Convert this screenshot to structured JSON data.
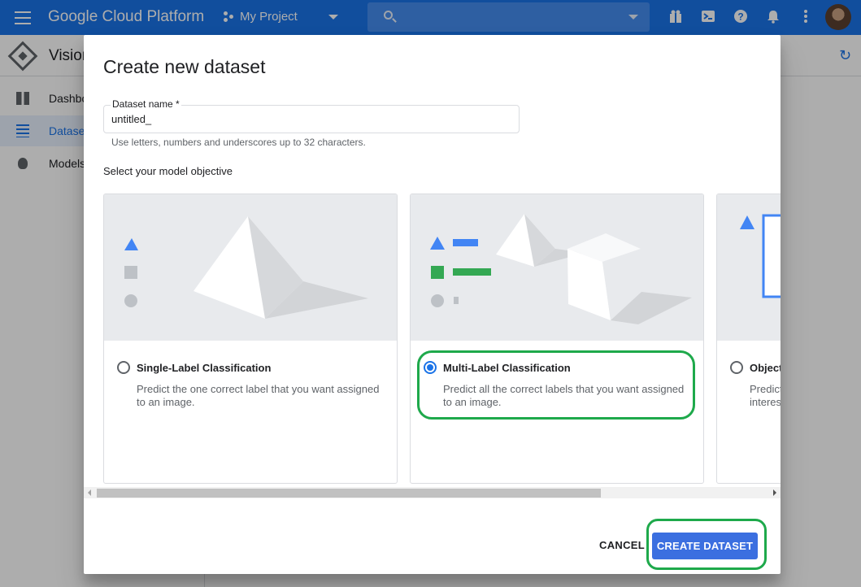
{
  "app": {
    "brand": "Google Cloud Platform",
    "project": "My Project",
    "section_title": "Vision"
  },
  "topbar": {
    "icons": [
      "menu-icon",
      "gift-icon",
      "cloud-shell-icon",
      "help-icon",
      "notifications-icon",
      "more-vert-icon"
    ],
    "search_placeholder": ""
  },
  "sidebar": {
    "items": [
      {
        "label": "Dashboard",
        "icon": "dashboard-icon",
        "active": false
      },
      {
        "label": "Datasets",
        "icon": "list-icon",
        "active": true
      },
      {
        "label": "Models",
        "icon": "lightbulb-icon",
        "active": false
      }
    ]
  },
  "dialog": {
    "title": "Create new dataset",
    "dataset_name_label": "Dataset name *",
    "dataset_name_value": "untitled_",
    "dataset_name_hint": "Use letters, numbers and underscores up to 32 characters.",
    "objective_label": "Select your model objective",
    "objectives": [
      {
        "title": "Single-Label Classification",
        "description": "Predict the one correct label that you want assigned to an image.",
        "selected": false
      },
      {
        "title": "Multi-Label Classification",
        "description": "Predict all the correct labels that you want assigned to an image.",
        "selected": true
      },
      {
        "title": "Object",
        "description": "Predict interes",
        "selected": false
      }
    ],
    "cancel_label": "CANCEL",
    "create_label": "CREATE DATASET"
  },
  "colors": {
    "topbar": "#1a73e8",
    "primary_button": "#3b6fe0",
    "highlight": "#1ea94b",
    "art_blue": "#4285f4",
    "art_green": "#34a853",
    "art_gray": "#bdc1c6"
  }
}
